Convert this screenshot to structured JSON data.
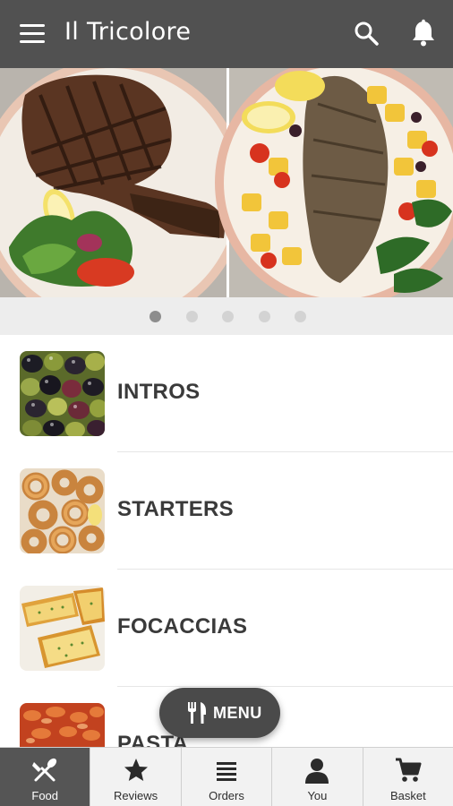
{
  "header": {
    "title": "Il Tricolore",
    "bg_color": "#515151"
  },
  "carousel": {
    "slide_count": 5,
    "active_index": 0
  },
  "categories": [
    {
      "label": "INTROS",
      "thumb_icon": "olives-thumbnail"
    },
    {
      "label": "STARTERS",
      "thumb_icon": "calamari-thumbnail"
    },
    {
      "label": "FOCACCIAS",
      "thumb_icon": "garlic-bread-thumbnail"
    },
    {
      "label": "PASTA",
      "thumb_icon": "pasta-thumbnail"
    }
  ],
  "fab": {
    "label": "MENU",
    "icon": "cutlery-icon"
  },
  "tabs": [
    {
      "label": "Food",
      "icon": "food-icon",
      "active": true
    },
    {
      "label": "Reviews",
      "icon": "star-icon",
      "active": false
    },
    {
      "label": "Orders",
      "icon": "list-icon",
      "active": false
    },
    {
      "label": "You",
      "icon": "user-icon",
      "active": false
    },
    {
      "label": "Basket",
      "icon": "cart-icon",
      "active": false
    }
  ]
}
